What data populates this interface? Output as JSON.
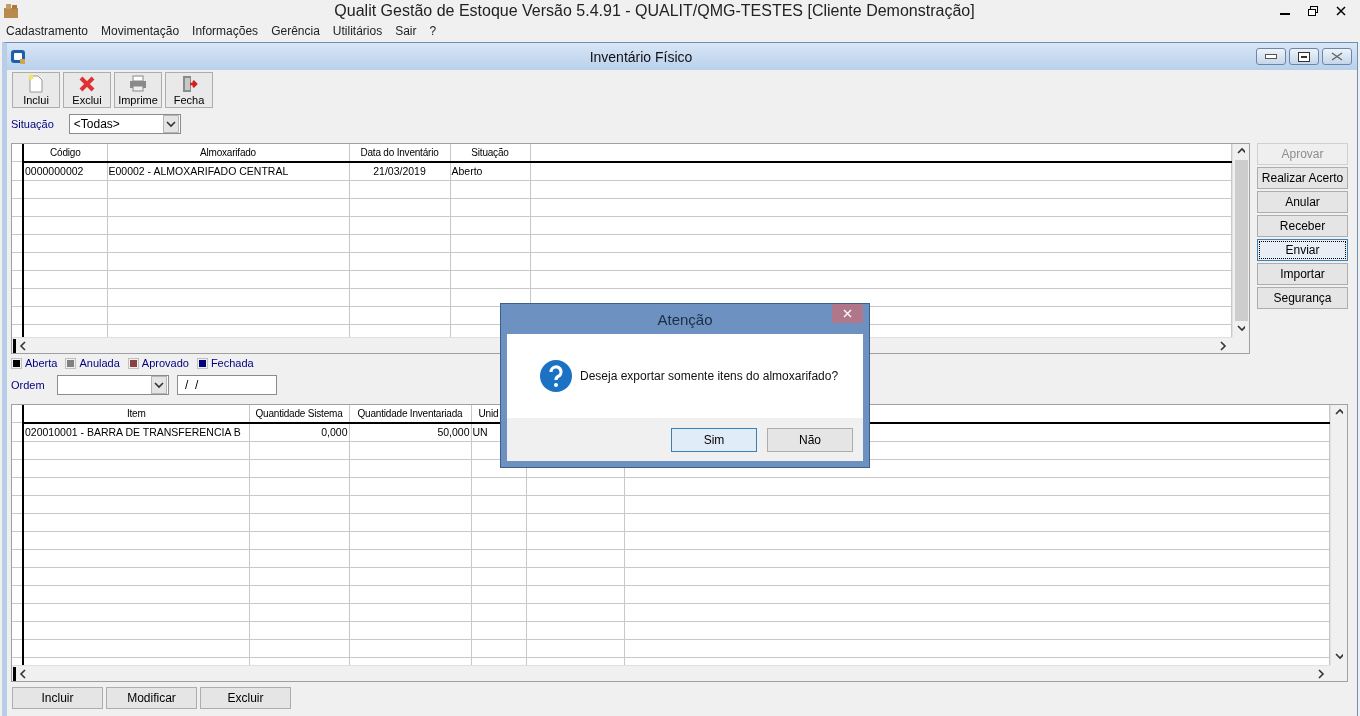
{
  "app_window": {
    "title": "Qualit Gestão de Estoque Versão 5.4.91 - QUALIT/QMG-TESTES [Cliente Demonstração]"
  },
  "menu": [
    "Cadastramento",
    "Movimentação",
    "Informações",
    "Gerência",
    "Utilitários",
    "Sair",
    "?"
  ],
  "child_window": {
    "title": "Inventário Físico"
  },
  "toolbar": [
    {
      "label": "Inclui",
      "kind": "new"
    },
    {
      "label": "Exclui",
      "kind": "delete"
    },
    {
      "label": "Imprime",
      "kind": "print"
    },
    {
      "label": "Fecha",
      "kind": "exit"
    }
  ],
  "filter": {
    "label": "Situação",
    "value": "<Todas>"
  },
  "inventory_table": {
    "columns": [
      "Código",
      "Almoxarifado",
      "Data do Inventário",
      "Situação"
    ],
    "rows": [
      [
        "0000000002",
        "E00002 - ALMOXARIFADO CENTRAL",
        "21/03/2019",
        "Aberto"
      ]
    ]
  },
  "side_buttons": [
    {
      "label": "Aprovar",
      "disabled": true,
      "focused": false
    },
    {
      "label": "Realizar Acerto",
      "disabled": false,
      "focused": false
    },
    {
      "label": "Anular",
      "disabled": false,
      "focused": false
    },
    {
      "label": "Receber",
      "disabled": false,
      "focused": false
    },
    {
      "label": "Enviar",
      "disabled": false,
      "focused": true
    },
    {
      "label": "Importar",
      "disabled": false,
      "focused": false
    },
    {
      "label": "Segurança",
      "disabled": false,
      "focused": false
    }
  ],
  "legend": [
    {
      "label": "Aberta",
      "color": "#000000"
    },
    {
      "label": "Anulada",
      "color": "#808080"
    },
    {
      "label": "Aprovado",
      "color": "#8b4040"
    },
    {
      "label": "Fechada",
      "color": "#000080"
    }
  ],
  "order": {
    "label": "Ordem",
    "date_value": " /  /"
  },
  "items_table": {
    "columns": [
      "Item",
      "Quantidade Sistema",
      "Quantidade Inventariada",
      "Unid"
    ],
    "rows": [
      [
        "020010001 - BARRA DE TRANSFERENCIA B",
        "0,000",
        "50,000",
        "UN"
      ]
    ]
  },
  "bottom_buttons": [
    "Incluir",
    "Modificar",
    "Excluir"
  ],
  "dialog": {
    "title": "Atenção",
    "message": "Deseja exportar somente itens do almoxarifado?",
    "buttons": [
      {
        "label": "Sim",
        "focused": true
      },
      {
        "label": "Não",
        "focused": false
      }
    ]
  }
}
